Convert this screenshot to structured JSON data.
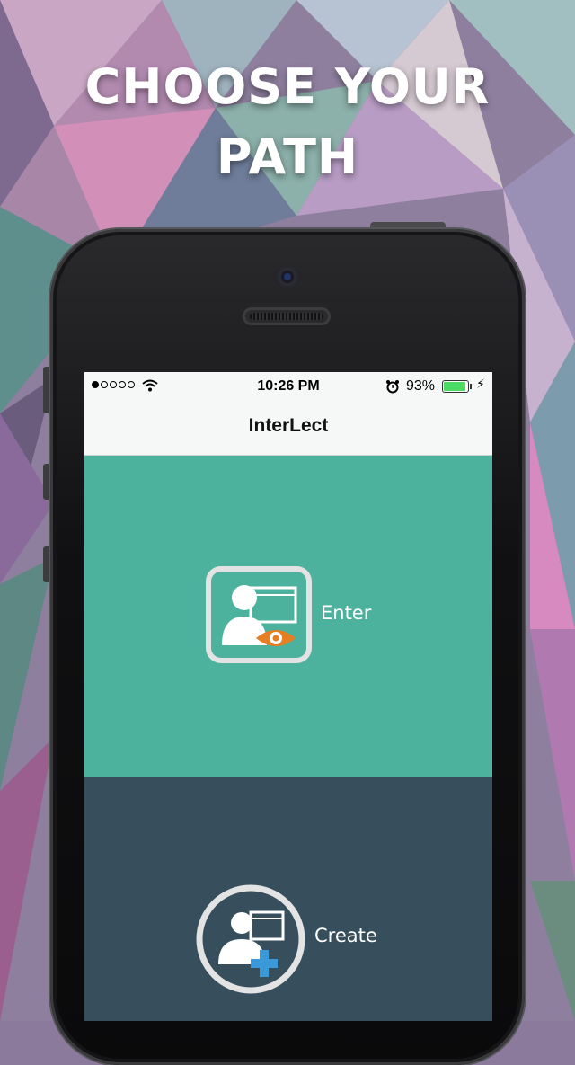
{
  "promo": {
    "headline_line1": "CHOOSE YOUR",
    "headline_line2": "PATH"
  },
  "status_bar": {
    "time": "10:26 PM",
    "battery_percent": "93%",
    "battery_level": 0.93,
    "signal_bars_filled": 1,
    "signal_bars_total": 5
  },
  "nav": {
    "title": "InterLect"
  },
  "options": {
    "enter_label": "Enter",
    "create_label": "Create"
  },
  "colors": {
    "enter_panel": "#4db29d",
    "create_panel": "#374e5c",
    "accent_orange": "#e67e22",
    "accent_blue": "#3a9ad9",
    "icon_frame": "#e3e3e3"
  },
  "icons": {
    "enter": "user-with-eye-icon",
    "create": "user-with-plus-icon"
  }
}
